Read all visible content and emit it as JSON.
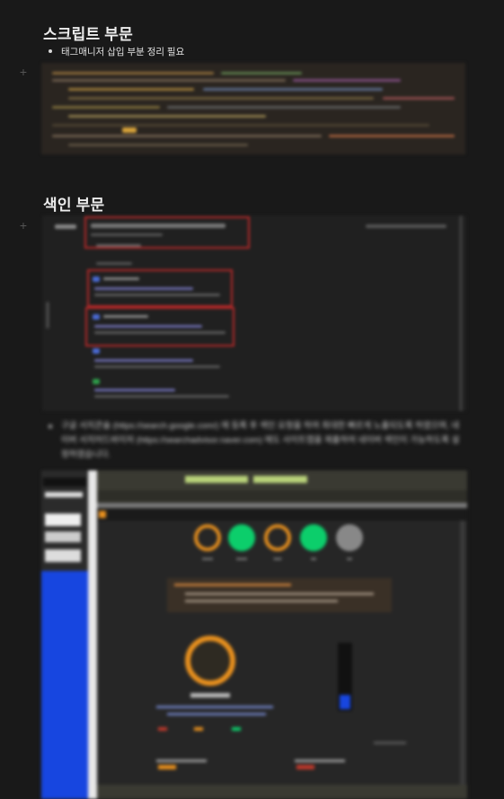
{
  "sections": {
    "script": {
      "heading": "스크립트 부문",
      "bullet": "태그매니저 삽입 부분 정리 필요"
    },
    "index": {
      "heading": "색인 부문",
      "paragraph": "구글 서치콘솔 (https://search.google.com/) 에 등록 후 색인 요청을 하여 최대한 빠르게 노출되도록 하였으며, 네이버 서치어드바이저 (https://searchadvisor.naver.com) 에도 사이트맵을 제출하여 네이버 색인이 가능하도록 설정하였습니다."
    }
  },
  "colors": {
    "background": "#191919",
    "heading": "#ececec",
    "highlight_red": "#b32828",
    "lighthouse_orange": "#e8901e",
    "lighthouse_green": "#0cce6b",
    "sidebar_blue": "#1746e0"
  },
  "icons": {
    "block_add": "plus-icon"
  }
}
